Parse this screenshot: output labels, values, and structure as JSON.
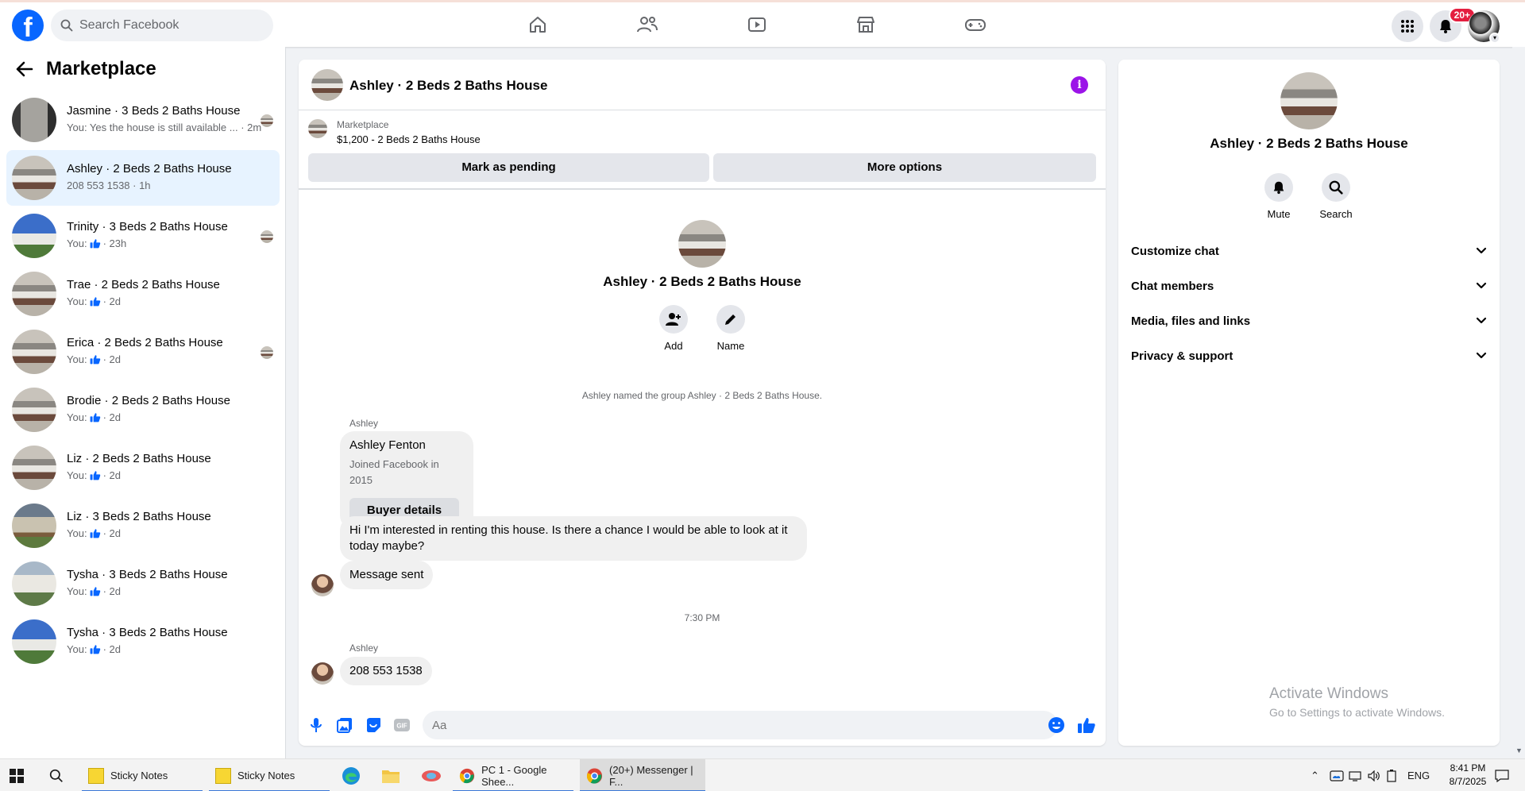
{
  "topbar": {
    "logo": "f",
    "search_placeholder": "Search Facebook",
    "notification_count": "20+",
    "nav_icons": [
      "home-icon",
      "friends-icon",
      "video-icon",
      "marketplace-icon",
      "gaming-icon"
    ]
  },
  "left_panel": {
    "title": "Marketplace",
    "conversations": [
      {
        "title": "Jasmine · 3 Beds 2 Baths House",
        "subtitle": "You: Yes the house is still available ... · 2m",
        "thumb": "t-hall",
        "active": false,
        "mini": true
      },
      {
        "title": "Ashley · 2 Beds 2 Baths House",
        "subtitle": "208 553 1538 · 1h",
        "thumb": "t-interior",
        "active": true,
        "mini": false
      },
      {
        "title": "Trinity · 3 Beds 2 Baths House",
        "prefix": "You:",
        "time": "· 23h",
        "thumb": "t-house-blue",
        "active": false,
        "mini": true
      },
      {
        "title": "Trae · 2 Beds 2 Baths House",
        "prefix": "You:",
        "time": "· 2d",
        "thumb": "t-interior",
        "active": false,
        "mini": false
      },
      {
        "title": "Erica · 2 Beds 2 Baths House",
        "prefix": "You:",
        "time": "· 2d",
        "thumb": "t-interior",
        "active": false,
        "mini": true
      },
      {
        "title": "Brodie · 2 Beds 2 Baths House",
        "prefix": "You:",
        "time": "· 2d",
        "thumb": "t-interior",
        "active": false,
        "mini": false
      },
      {
        "title": "Liz · 2 Beds 2 Baths House",
        "prefix": "You:",
        "time": "· 2d",
        "thumb": "t-interior",
        "active": false,
        "mini": false
      },
      {
        "title": "Liz · 3 Beds 2 Baths House",
        "prefix": "You:",
        "time": "· 2d",
        "thumb": "t-house-porch",
        "active": false,
        "mini": false
      },
      {
        "title": "Tysha · 3 Beds 2 Baths House",
        "prefix": "You:",
        "time": "· 2d",
        "thumb": "t-house-white",
        "active": false,
        "mini": false
      },
      {
        "title": "Tysha · 3 Beds 2 Baths House",
        "prefix": "You:",
        "time": "· 2d",
        "thumb": "t-house-blue",
        "active": false,
        "mini": false
      }
    ]
  },
  "chat": {
    "title": "Ashley · 2 Beds 2 Baths House",
    "listing_source": "Marketplace",
    "listing_price": "$1,200 - 2 Beds 2 Baths House",
    "mark_pending_label": "Mark as pending",
    "more_options_label": "More options",
    "intro_name": "Ashley · 2 Beds 2 Baths House",
    "add_label": "Add",
    "name_label": "Name",
    "system_message": "Ashley named the group Ashley · 2 Beds 2 Baths House.",
    "sender_1": "Ashley",
    "card_name": "Ashley Fenton",
    "card_sub": "Joined Facebook in 2015",
    "buyer_details_label": "Buyer details",
    "message_1": "Hi I'm interested in renting this house. Is there a chance I would be able to look at it today maybe?",
    "message_2": "Message sent",
    "timestamp": "7:30 PM",
    "sender_2": "Ashley",
    "message_3": "208 553 1538",
    "input_placeholder": "Aa"
  },
  "right_panel": {
    "name": "Ashley · 2 Beds 2 Baths House",
    "mute_label": "Mute",
    "search_label": "Search",
    "sections": [
      "Customize chat",
      "Chat members",
      "Media, files and links",
      "Privacy & support"
    ],
    "watermark_1": "Activate Windows",
    "watermark_2": "Go to Settings to activate Windows."
  },
  "taskbar": {
    "items": [
      "Sticky Notes",
      "Sticky Notes",
      "PC 1 - Google Shee...",
      "(20+) Messenger | F..."
    ],
    "lang": "ENG",
    "time": "8:41 PM",
    "date": "8/7/2025"
  },
  "colors": {
    "brand": "#0866ff",
    "accent_purple": "#9b14e8",
    "badge_red": "#e41e3f",
    "active_row": "#e7f3ff"
  }
}
